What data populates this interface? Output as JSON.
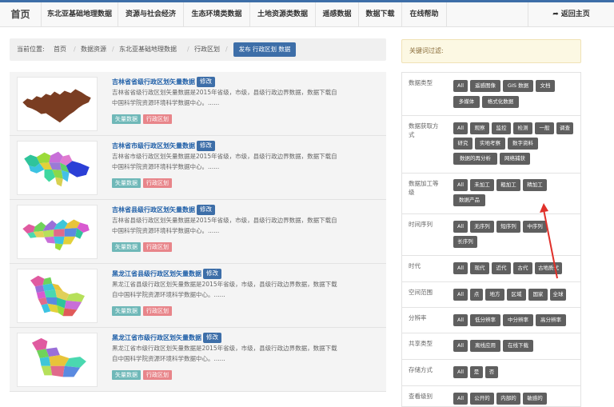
{
  "nav": {
    "brand": "首页",
    "items": [
      "东北亚基础地理数据",
      "资源与社会经济",
      "生态环境类数据",
      "土地资源类数据",
      "遥感数据",
      "数据下载",
      "在线帮助"
    ],
    "home": "返回主页"
  },
  "breadcrumb": {
    "prefix": "当前位置:",
    "items": [
      "首页",
      "数据资源",
      "东北亚基础地理数据",
      "行政区划"
    ],
    "publish": "发布 行政区划 数据"
  },
  "keyword_filter": "关键词过滤:",
  "datasets": [
    {
      "title": "吉林省省级行政区划矢量数据",
      "edit": "修改",
      "desc1": "吉林省省级行政区划矢量数据是2015年省级，市级，县级行政边界数据，数据下载自",
      "desc2": "中国科学院资源环境科学数据中心。......",
      "tags": [
        "矢量数据",
        "行政区划"
      ]
    },
    {
      "title": "吉林省市级行政区划矢量数据",
      "edit": "修改",
      "desc1": "吉林省市级行政区划矢量数据是2015年省级，市级，县级行政边界数据，数据下载自",
      "desc2": "中国科学院资源环境科学数据中心。......",
      "tags": [
        "矢量数据",
        "行政区划"
      ]
    },
    {
      "title": "吉林省县级行政区划矢量数据",
      "edit": "修改",
      "desc1": "吉林省县级行政区划矢量数据是2015年省级，市级，县级行政边界数据，数据下载自",
      "desc2": "中国科学院资源环境科学数据中心。......",
      "tags": [
        "矢量数据",
        "行政区划"
      ]
    },
    {
      "title": "黑龙江省县级行政区划矢量数据",
      "edit": "修改",
      "desc1": "黑龙江省县级行政区划矢量数据是2015年省级，市级，县级行政边界数据，数据下载",
      "desc2": "自中国科学院资源环境科学数据中心。......",
      "tags": [
        "矢量数据",
        "行政区划"
      ]
    },
    {
      "title": "黑龙江省市级行政区划矢量数据",
      "edit": "修改",
      "desc1": "黑龙江省市级行政区划矢量数据是2015年省级，市级，县级行政边界数据，数据下载",
      "desc2": "自中国科学院资源环境科学数据中心。......",
      "tags": [
        "矢量数据",
        "行政区划"
      ]
    }
  ],
  "filters": [
    {
      "label": "数据类型",
      "options": [
        "All",
        "遥感图像",
        "GIS 数据",
        "文档",
        "多媒体",
        "格式化数据"
      ]
    },
    {
      "label": "数据获取方式",
      "options": [
        "All",
        "观察",
        "监控",
        "检测",
        "一般",
        "调查",
        "研究",
        "实地考察",
        "数字资料",
        "数据的再分析",
        "网络捕获"
      ]
    },
    {
      "label": "数据加工等级",
      "options": [
        "All",
        "未加工",
        "粗加工",
        "精加工",
        "数据产品"
      ]
    },
    {
      "label": "时间序列",
      "options": [
        "All",
        "无序列",
        "短序列",
        "中序列",
        "长序列"
      ]
    },
    {
      "label": "时代",
      "options": [
        "All",
        "现代",
        "近代",
        "古代",
        "古地质代"
      ]
    },
    {
      "label": "空间范围",
      "options": [
        "All",
        "点",
        "地方",
        "区域",
        "国家",
        "全球"
      ]
    },
    {
      "label": "分辨率",
      "options": [
        "All",
        "低分辨率",
        "中分辨率",
        "高分辨率"
      ]
    },
    {
      "label": "共享类型",
      "options": [
        "All",
        "离线应用",
        "在线下载"
      ]
    },
    {
      "label": "存储方式",
      "options": [
        "All",
        "是",
        "否"
      ]
    },
    {
      "label": "查看级别",
      "options": [
        "All",
        "公开的",
        "内部的",
        "敏感的"
      ]
    }
  ],
  "colors": {
    "accent": "#3d6ea8",
    "chip": "#5f5f5f",
    "tag_vector": "#6fb8b8",
    "tag_admin": "#e8858a",
    "annotation": "#e0302a"
  }
}
